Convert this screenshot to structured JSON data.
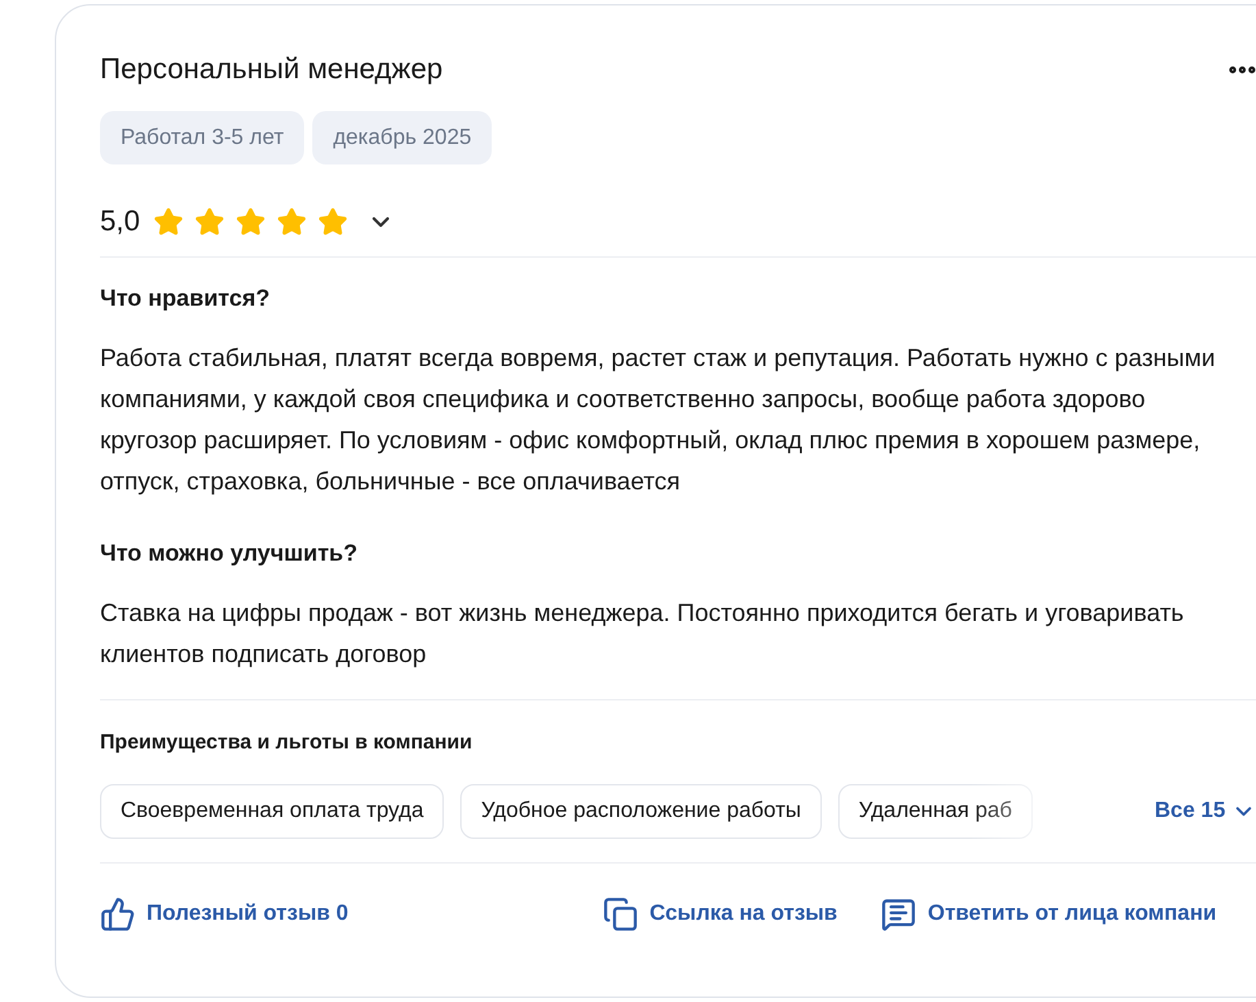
{
  "review": {
    "title": "Персональный менеджер",
    "tags": [
      "Работал 3-5 лет",
      "декабрь 2025"
    ],
    "rating": {
      "value": "5,0",
      "stars": 5,
      "expanded": false
    },
    "sections": [
      {
        "heading": "Что нравится?",
        "text": "Работа стабильная, платят всегда вовремя, растет стаж и репутация. Работать нужно с разными компаниями, у каждой своя специфика и соответственно запросы, вообще работа здорово кругозор расширяет. По условиям - офис комфортный, оклад плюс премия в хорошем размере, отпуск, страховка, больничные - все оплачивается"
      },
      {
        "heading": "Что можно улучшить?",
        "text": "Ставка на цифры продаж - вот жизнь менеджера. Постоянно приходится бегать и уговаривать клиентов подписать договор"
      }
    ],
    "benefits": {
      "heading": "Преимущества и льготы в компании",
      "items": [
        "Своевременная оплата труда",
        "Удобное расположение работы",
        "Удаленная раб"
      ],
      "more": "Все 15"
    },
    "actions": [
      {
        "kind": "like",
        "label": "Полезный отзыв 0"
      },
      {
        "kind": "copy",
        "label": "Ссылка на отзыв"
      },
      {
        "kind": "reply",
        "label": "Ответить от лица компани"
      }
    ]
  }
}
